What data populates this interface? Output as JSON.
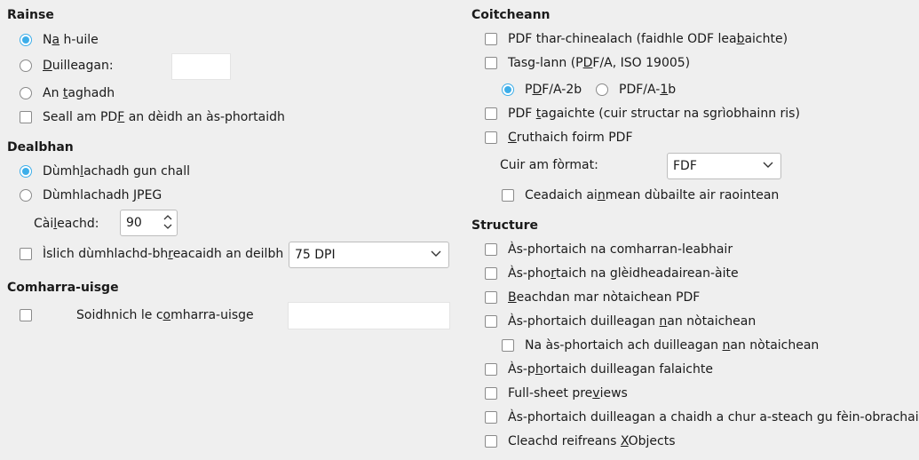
{
  "range": {
    "header": "Rainse",
    "all_pre": "N",
    "all_u": "a",
    "all_post": " h-uile",
    "pages_u": "D",
    "pages_post": "uilleagan:",
    "pages_value": "",
    "selection_pre": "An ",
    "selection_u": "t",
    "selection_post": "aghadh",
    "view_pre": "Seall am PD",
    "view_u": "F",
    "view_post": " an dèidh an às-phortaidh"
  },
  "images": {
    "header": "Dealbhan",
    "lossless_pre": "Dùmh",
    "lossless_u": "l",
    "lossless_post": "achadh gun chall",
    "jpeg_pre": "Dùmhlachadh ",
    "jpeg_u": "J",
    "jpeg_post": "PEG",
    "quality_pre": "Cài",
    "quality_u": "l",
    "quality_post": "eachd:",
    "quality_value": "90",
    "reduce_pre": "Ìslich dùmhlachd-bh",
    "reduce_u": "r",
    "reduce_post": "eacaidh an deilbh",
    "reduce_value": "75 DPI"
  },
  "watermark": {
    "header": "Comharra-uisge",
    "sign_pre": "Soidhnich le c",
    "sign_u": "o",
    "sign_post": "mharra-uisge",
    "text_value": ""
  },
  "general": {
    "header": "Coitcheann",
    "hybrid_pre": "PDF thar-chinealach (faidhle ODF lea",
    "hybrid_u": "b",
    "hybrid_post": "aichte)",
    "archive_pre": "Tasg-lann (P",
    "archive_u": "D",
    "archive_post": "F/A, ISO 19005)",
    "pdfa2b_pre": "P",
    "pdfa2b_u": "D",
    "pdfa2b_post": "F/A-2b",
    "pdfa1b_pre": "PDF/A-",
    "pdfa1b_u": "1",
    "pdfa1b_post": "b",
    "tagged_pre": "PDF ",
    "tagged_u": "t",
    "tagged_post": "agaichte (cuir structar na sgrìobhainn ris)",
    "form_pre": "",
    "form_u": "C",
    "form_post": "ruthaich foirm PDF",
    "format_label": "Cuir am fòrmat:",
    "format_value": "FDF",
    "dupnames_pre": "Ceadaich ai",
    "dupnames_u": "n",
    "dupnames_post": "mean dùbailte air raointean"
  },
  "structure": {
    "header": "Structure",
    "bookmarks": "Às-phortaich na comharran-leabhair",
    "placeholders_pre": "Às-pho",
    "placeholders_u": "r",
    "placeholders_post": "taich na glèidheadairean-àite",
    "comments_pre": "",
    "comments_u": "B",
    "comments_post": "eachdan mar nòtaichean PDF",
    "notespages_pre": "Às-phortaich duilleagan ",
    "notespages_u": "n",
    "notespages_post": "an nòtaichean",
    "onlynotes_pre": "Na às-phortaich ach duilleagan ",
    "onlynotes_u": "n",
    "onlynotes_post": "an nòtaichean",
    "hidden_pre": "Às-p",
    "hidden_u": "h",
    "hidden_post": "ortaich duilleagan falaichte",
    "fullsheet_pre": "Full-sheet pre",
    "fullsheet_u": "v",
    "fullsheet_post": "iews",
    "blank": "Às-phortaich duilleagan a chaidh a chur a-steach gu fèin-obrachail",
    "xobjects_pre": "Cleachd reifreans ",
    "xobjects_u": "X",
    "xobjects_post": "Objects"
  },
  "colors": {
    "accent": "#3daee9",
    "background": "#efefef"
  }
}
